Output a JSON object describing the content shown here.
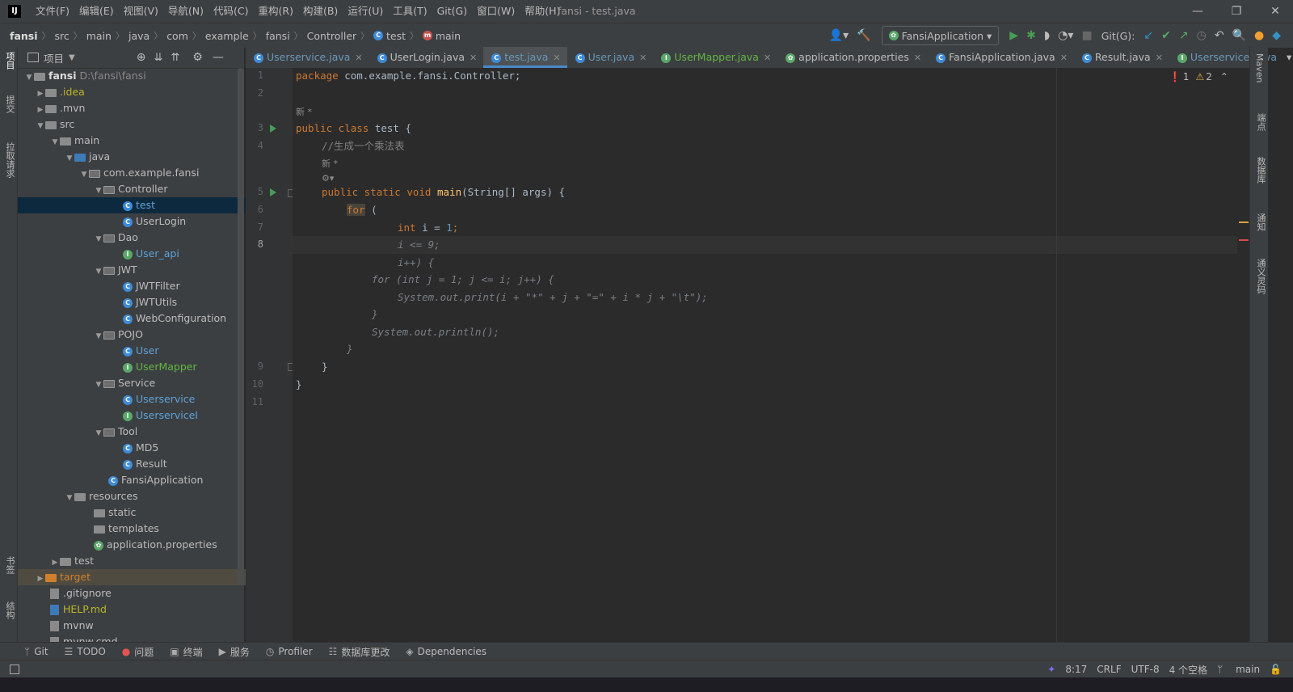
{
  "menu": [
    "文件(F)",
    "编辑(E)",
    "视图(V)",
    "导航(N)",
    "代码(C)",
    "重构(R)",
    "构建(B)",
    "运行(U)",
    "工具(T)",
    "Git(G)",
    "窗口(W)",
    "帮助(H)"
  ],
  "window_title": "fansi - test.java",
  "breadcrumb": [
    "fansi",
    "src",
    "main",
    "java",
    "com",
    "example",
    "fansi",
    "Controller",
    "test",
    "main"
  ],
  "run_config": "FansiApplication",
  "git_label": "Git(G):",
  "left_strip": [
    "项目",
    "提交",
    "拉取请求",
    "书签",
    "结构"
  ],
  "right_strip": [
    "Maven",
    "端点",
    "数据库",
    "通知",
    "通义灵码"
  ],
  "project": {
    "title": "项目",
    "tree": [
      {
        "label": "fansi",
        "extra": "D:\\fansi\\fansi"
      },
      {
        "label": ".idea"
      },
      {
        "label": ".mvn"
      },
      {
        "label": "src"
      },
      {
        "label": "main"
      },
      {
        "label": "java"
      },
      {
        "label": "com.example.fansi"
      },
      {
        "label": "Controller"
      },
      {
        "label": "test"
      },
      {
        "label": "UserLogin"
      },
      {
        "label": "Dao"
      },
      {
        "label": "User_api"
      },
      {
        "label": "JWT"
      },
      {
        "label": "JWTFilter"
      },
      {
        "label": "JWTUtils"
      },
      {
        "label": "WebConfiguration"
      },
      {
        "label": "POJO"
      },
      {
        "label": "User"
      },
      {
        "label": "UserMapper"
      },
      {
        "label": "Service"
      },
      {
        "label": "Userservice"
      },
      {
        "label": "UserserviceI"
      },
      {
        "label": "Tool"
      },
      {
        "label": "MD5"
      },
      {
        "label": "Result"
      },
      {
        "label": "FansiApplication"
      },
      {
        "label": "resources"
      },
      {
        "label": "static"
      },
      {
        "label": "templates"
      },
      {
        "label": "application.properties"
      },
      {
        "label": "test"
      },
      {
        "label": "target"
      },
      {
        "label": ".gitignore"
      },
      {
        "label": "HELP.md"
      },
      {
        "label": "mvnw"
      },
      {
        "label": "mvnw.cmd"
      }
    ]
  },
  "tabs": [
    "Userservice.java",
    "UserLogin.java",
    "test.java",
    "User.java",
    "UserMapper.java",
    "application.properties",
    "FansiApplication.java",
    "Result.java",
    "UserserviceI.java"
  ],
  "inspections": {
    "errors": "1",
    "warnings": "2"
  },
  "line_numbers": [
    "1",
    "2",
    "3",
    "4",
    "5",
    "6",
    "7",
    "8",
    "9",
    "10",
    "11"
  ],
  "code": {
    "l1_kw": "package",
    "l1_rest": " com.example.fansi.Controller;",
    "hint_new": "新 *",
    "l3_kw": "public class",
    "l3_rest": " test {",
    "l4_comment": "//生成一个乘法表",
    "l5_kw": "public static void",
    "l5_fn": "main",
    "l5_rest": "(String[] args) {",
    "l6_kw": "for",
    "l6_rest": " (",
    "l7_kw": "int",
    "l7_a": " i = ",
    "l7_num": "1",
    "l7_b": ";",
    "l8": "i <= 9;",
    "g1": "i++) {",
    "g2": "for (int j = 1; j <= i; j++) {",
    "g3": "System.out.print(i + \"*\" + j + \"=\" + i * j + \"\\t\");",
    "g4": "}",
    "g5": "System.out.println();",
    "g6": "}",
    "l9": "}",
    "l10": "}"
  },
  "toolwindows": [
    "Git",
    "TODO",
    "问题",
    "终端",
    "服务",
    "Profiler",
    "数据库更改",
    "Dependencies"
  ],
  "status": {
    "position": "8:17",
    "line_sep": "CRLF",
    "encoding": "UTF-8",
    "indent": "4 个空格",
    "branch": "main"
  }
}
